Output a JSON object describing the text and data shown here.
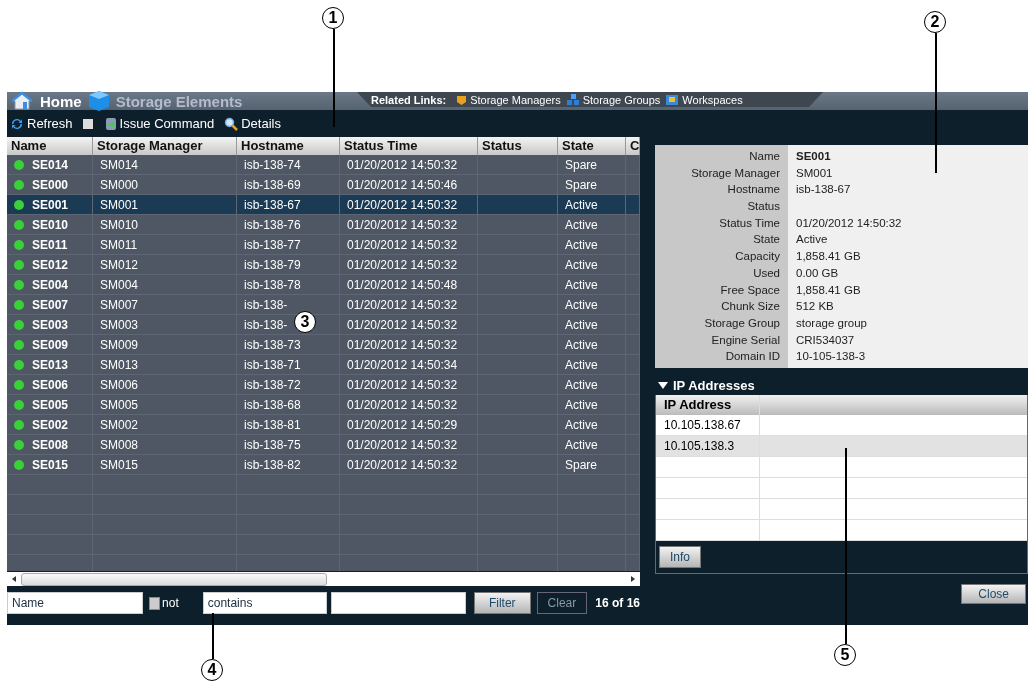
{
  "callouts": [
    {
      "label": "1"
    },
    {
      "label": "2"
    },
    {
      "label": "3"
    },
    {
      "label": "4"
    },
    {
      "label": "5"
    }
  ],
  "header": {
    "home": "Home",
    "title": "Storage Elements",
    "related_label": "Related Links:",
    "related_links": [
      {
        "label": "Storage Managers",
        "kind": "manager"
      },
      {
        "label": "Storage Groups",
        "kind": "group"
      },
      {
        "label": "Workspaces",
        "kind": "workspace"
      }
    ]
  },
  "toolbar": [
    {
      "label": "Refresh",
      "kind": "refresh"
    },
    {
      "label": "Issue Command",
      "kind": "command"
    },
    {
      "label": "Details",
      "kind": "details"
    }
  ],
  "table": {
    "columns": [
      "Name",
      "Storage Manager",
      "Hostname",
      "Status Time",
      "Status",
      "State",
      "C"
    ],
    "rows": [
      {
        "name": "SE014",
        "storage_manager": "SM014",
        "hostname": "isb-138-74",
        "status_time": "01/20/2012 14:50:32",
        "state": "Spare",
        "selected": false
      },
      {
        "name": "SE000",
        "storage_manager": "SM000",
        "hostname": "isb-138-69",
        "status_time": "01/20/2012 14:50:46",
        "state": "Spare",
        "selected": false
      },
      {
        "name": "SE001",
        "storage_manager": "SM001",
        "hostname": "isb-138-67",
        "status_time": "01/20/2012 14:50:32",
        "state": "Active",
        "selected": true
      },
      {
        "name": "SE010",
        "storage_manager": "SM010",
        "hostname": "isb-138-76",
        "status_time": "01/20/2012 14:50:32",
        "state": "Active",
        "selected": false
      },
      {
        "name": "SE011",
        "storage_manager": "SM011",
        "hostname": "isb-138-77",
        "status_time": "01/20/2012 14:50:32",
        "state": "Active",
        "selected": false
      },
      {
        "name": "SE012",
        "storage_manager": "SM012",
        "hostname": "isb-138-79",
        "status_time": "01/20/2012 14:50:32",
        "state": "Active",
        "selected": false
      },
      {
        "name": "SE004",
        "storage_manager": "SM004",
        "hostname": "isb-138-78",
        "status_time": "01/20/2012 14:50:48",
        "state": "Active",
        "selected": false
      },
      {
        "name": "SE007",
        "storage_manager": "SM007",
        "hostname": "isb-138-",
        "status_time": "01/20/2012 14:50:32",
        "state": "Active",
        "selected": false
      },
      {
        "name": "SE003",
        "storage_manager": "SM003",
        "hostname": "isb-138-",
        "status_time": "01/20/2012 14:50:32",
        "state": "Active",
        "selected": false
      },
      {
        "name": "SE009",
        "storage_manager": "SM009",
        "hostname": "isb-138-73",
        "status_time": "01/20/2012 14:50:32",
        "state": "Active",
        "selected": false
      },
      {
        "name": "SE013",
        "storage_manager": "SM013",
        "hostname": "isb-138-71",
        "status_time": "01/20/2012 14:50:34",
        "state": "Active",
        "selected": false
      },
      {
        "name": "SE006",
        "storage_manager": "SM006",
        "hostname": "isb-138-72",
        "status_time": "01/20/2012 14:50:32",
        "state": "Active",
        "selected": false
      },
      {
        "name": "SE005",
        "storage_manager": "SM005",
        "hostname": "isb-138-68",
        "status_time": "01/20/2012 14:50:32",
        "state": "Active",
        "selected": false
      },
      {
        "name": "SE002",
        "storage_manager": "SM002",
        "hostname": "isb-138-81",
        "status_time": "01/20/2012 14:50:29",
        "state": "Active",
        "selected": false
      },
      {
        "name": "SE008",
        "storage_manager": "SM008",
        "hostname": "isb-138-75",
        "status_time": "01/20/2012 14:50:32",
        "state": "Active",
        "selected": false
      },
      {
        "name": "SE015",
        "storage_manager": "SM015",
        "hostname": "isb-138-82",
        "status_time": "01/20/2012 14:50:32",
        "state": "Spare",
        "selected": false
      }
    ]
  },
  "filter": {
    "field": "Name",
    "not_checked": false,
    "not_label": "not",
    "operator": "contains",
    "filter_button": "Filter",
    "clear_button": "Clear",
    "clear_disabled": true,
    "count": "16 of 16"
  },
  "details": [
    {
      "label": "Name",
      "value": "SE001"
    },
    {
      "label": "Storage Manager",
      "value": "SM001"
    },
    {
      "label": "Hostname",
      "value": "isb-138-67"
    },
    {
      "label": "Status"
    },
    {
      "label": "Status Time",
      "value": "01/20/2012 14:50:32"
    },
    {
      "label": "State",
      "value": "Active"
    },
    {
      "label": "Capacity",
      "value": "1,858.41 GB"
    },
    {
      "label": "Used",
      "value": "0.00 GB"
    },
    {
      "label": "Free Space",
      "value": "1,858.41 GB"
    },
    {
      "label": "Chunk Size",
      "value": "512 KB"
    },
    {
      "label": "Storage Group",
      "value": "storage group"
    },
    {
      "label": "Engine Serial",
      "value": "CRI534037"
    },
    {
      "label": "Domain ID",
      "value": "10-105-138-3"
    }
  ],
  "ip_addresses": {
    "title": "IP Addresses",
    "expanded": true,
    "column": "IP Address",
    "rows": [
      {
        "address": "10.105.138.67",
        "selected": false
      },
      {
        "address": "10.105.138.3",
        "selected": true
      }
    ],
    "info_button": "Info"
  },
  "close_button": "Close"
}
